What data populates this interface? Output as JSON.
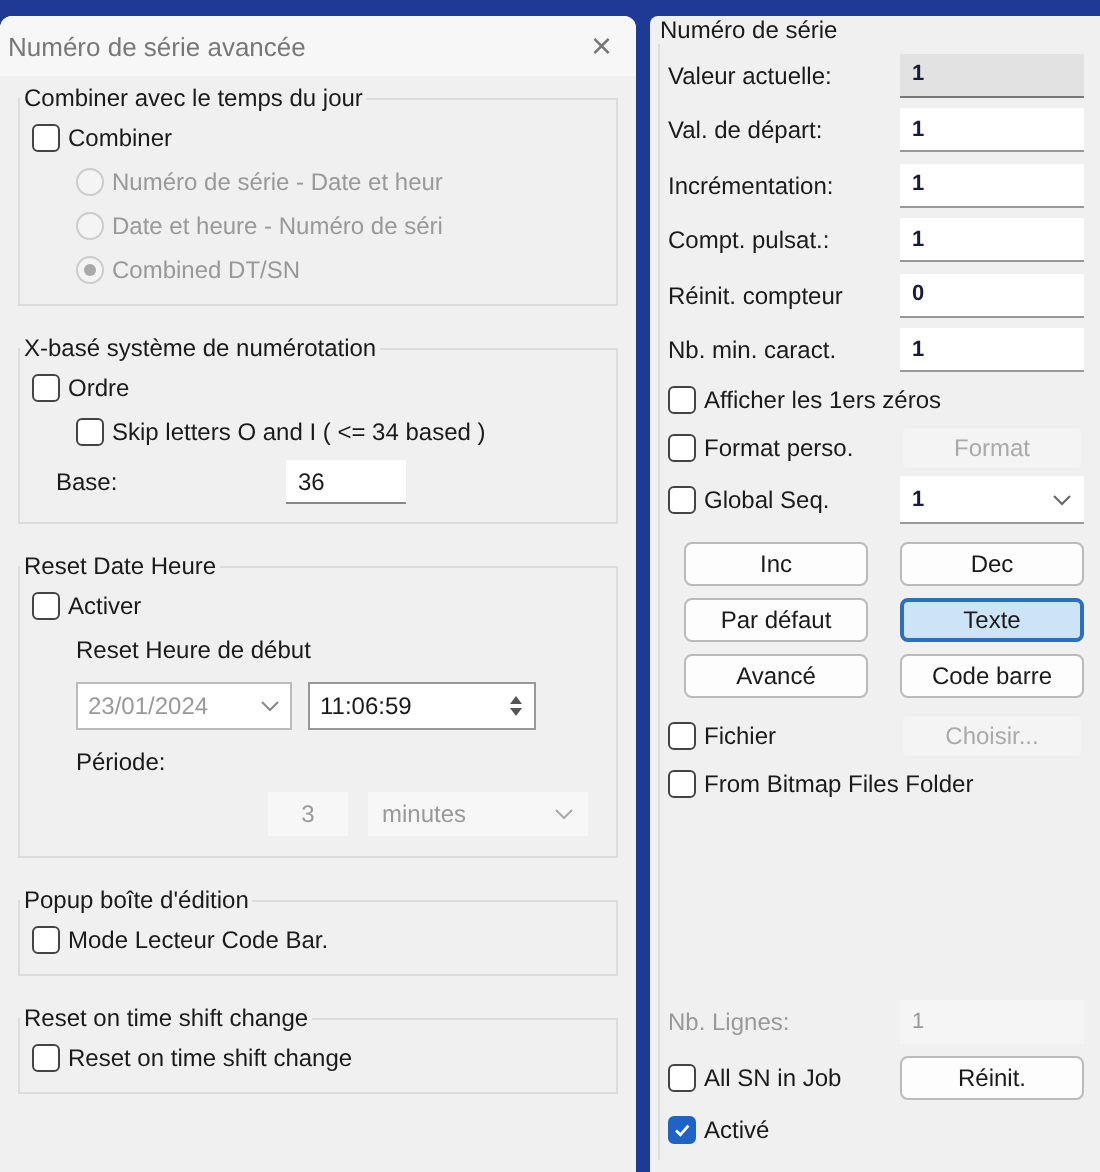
{
  "dialog": {
    "title": "Numéro de série avancée",
    "close": "×",
    "groups": [
      {
        "title": "Combiner avec le temps du jour",
        "items": [
          {
            "kind": "checkbox",
            "label": "Combiner",
            "checked": false
          },
          {
            "kind": "radio",
            "label": "Numéro de série - Date et heur",
            "selected": false,
            "disabled": true
          },
          {
            "kind": "radio",
            "label": "Date et heure - Numéro de séri",
            "selected": false,
            "disabled": true
          },
          {
            "kind": "radio",
            "label": "Combined DT/SN",
            "selected": true,
            "disabled": true
          }
        ]
      },
      {
        "title": "X-basé système de numérotation",
        "items": [
          {
            "kind": "checkbox",
            "label": "Ordre",
            "checked": false
          },
          {
            "kind": "sub_checkbox",
            "label": "Skip letters O and I ( <= 34 based )",
            "checked": false
          },
          {
            "kind": "field",
            "label": "Base:",
            "value": "36"
          }
        ]
      },
      {
        "title": "Reset Date Heure",
        "items": [
          {
            "kind": "checkbox",
            "label": "Activer",
            "checked": false
          },
          {
            "kind": "label",
            "label": "Reset Heure de début"
          },
          {
            "kind": "datetime",
            "date": "23/01/2024",
            "time": "11:06:59",
            "disabled": true
          },
          {
            "kind": "label",
            "label": "Période:"
          },
          {
            "kind": "period",
            "value": "3",
            "unit": "minutes",
            "disabled": true
          }
        ]
      },
      {
        "title": "Popup boîte d'édition",
        "items": [
          {
            "kind": "checkbox",
            "label": "Mode Lecteur Code Bar.",
            "checked": false
          }
        ]
      },
      {
        "title": "Reset on time shift change",
        "items": [
          {
            "kind": "checkbox",
            "label": "Reset on time shift change",
            "checked": false
          }
        ]
      }
    ]
  },
  "serial": {
    "title": "Numéro de série",
    "fields": [
      {
        "label": "Valeur actuelle:",
        "value": "1",
        "disabled": true
      },
      {
        "label": "Val. de départ:",
        "value": "1",
        "disabled": false
      },
      {
        "label": "Incrémentation:",
        "value": "1",
        "disabled": false
      },
      {
        "label": "Compt. pulsat.:",
        "value": "1",
        "disabled": false
      },
      {
        "label": "Réinit. compteur",
        "value": "0",
        "disabled": false
      },
      {
        "label": "Nb. min. caract.",
        "value": "1",
        "disabled": false
      }
    ],
    "options": [
      {
        "kind": "check",
        "label": "Afficher les 1ers zéros",
        "checked": false
      },
      {
        "kind": "check_button",
        "label": "Format perso.",
        "checked": false,
        "button": {
          "label": "Format",
          "disabled": true
        }
      },
      {
        "kind": "check_select",
        "label": "Global Seq.",
        "checked": false,
        "value": "1"
      }
    ],
    "buttons": [
      {
        "label": "Inc",
        "focused": false
      },
      {
        "label": "Dec",
        "focused": false
      },
      {
        "label": "Par défaut",
        "focused": false
      },
      {
        "label": "Texte",
        "focused": true
      },
      {
        "label": "Avancé",
        "focused": false
      },
      {
        "label": "Code barre",
        "focused": false
      }
    ],
    "file_options": [
      {
        "kind": "check_button",
        "label": "Fichier",
        "checked": false,
        "button": {
          "label": "Choisir...",
          "disabled": true
        }
      },
      {
        "kind": "check",
        "label": "From Bitmap Files Folder",
        "checked": false
      }
    ],
    "footer": [
      {
        "kind": "field",
        "label": "Nb. Lignes:",
        "value": "1",
        "disabled": true
      },
      {
        "kind": "check_button",
        "label": "All SN in Job",
        "checked": false,
        "button": {
          "label": "Réinit.",
          "disabled": false
        }
      },
      {
        "kind": "check",
        "label": "Activé",
        "checked": true
      }
    ]
  }
}
